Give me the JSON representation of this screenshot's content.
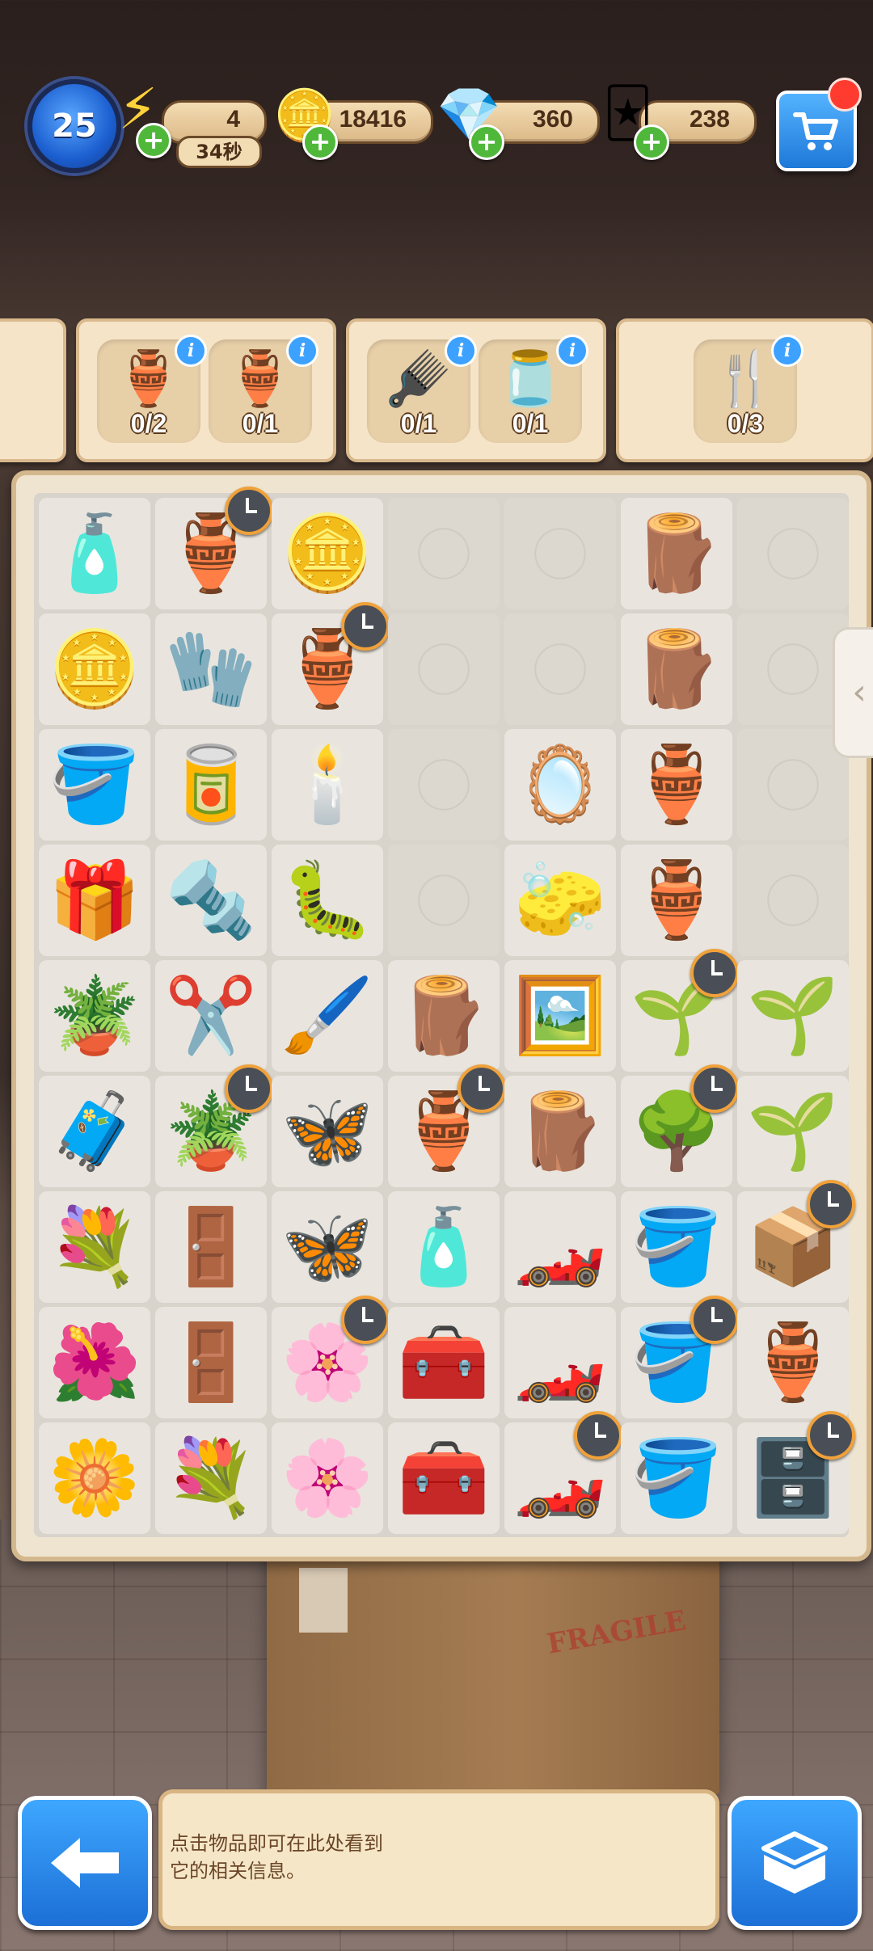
{
  "top_bar": {
    "level": "25",
    "energy": {
      "value": "4",
      "timer": "34秒",
      "icon": "lightning-icon"
    },
    "coins": {
      "value": "18416",
      "icon": "coin-icon"
    },
    "gems": {
      "value": "360",
      "icon": "diamond-icon"
    },
    "cards": {
      "value": "238",
      "icon": "card-icon"
    },
    "cart_icon": "shopping-cart-icon"
  },
  "orders": [
    {
      "items": [
        {
          "name": "golden-ewer",
          "glyph": "🏺",
          "count": "0/2"
        },
        {
          "name": "painted-vase",
          "glyph": "🏺",
          "count": "0/1"
        }
      ]
    },
    {
      "items": [
        {
          "name": "brush",
          "glyph": "🪮",
          "count": "0/1"
        },
        {
          "name": "cream-jar",
          "glyph": "🫙",
          "count": "0/1"
        }
      ]
    },
    {
      "items": [
        {
          "name": "cutlery",
          "glyph": "🍴",
          "count": "0/3"
        }
      ]
    }
  ],
  "board": {
    "rows": [
      [
        "🧴",
        "🏺",
        "🪙",
        "",
        "",
        "🪵"
      ],
      [
        "🪙",
        "🧤",
        "🏺",
        "",
        "",
        "🪵"
      ],
      [
        "🪣",
        "🥫",
        "🕯️",
        "",
        "🪞",
        "🏺"
      ],
      [
        "🎁",
        "🔩",
        "🐛",
        "",
        "🧽",
        "🏺"
      ],
      [
        "🪴",
        "✂️",
        "🖌️",
        "🪵",
        "🖼️",
        "🌱"
      ],
      [
        "🧳",
        "🪴",
        "🦋",
        "🏺",
        "🪵",
        "🌳"
      ],
      [
        "💐",
        "🚪",
        "🦋",
        "🧴",
        "🏎️",
        "🪣"
      ],
      [
        "🌺",
        "🚪",
        "🌸",
        "🧰",
        "🏎️",
        "🪣"
      ],
      [
        "🌼",
        "💐",
        "🌸",
        "🧰",
        "🏎️",
        "🪣"
      ]
    ],
    "extra_right_column": [
      "",
      "",
      "",
      "",
      "🌱",
      "🌱",
      "📦",
      "🏺",
      "🗄️"
    ]
  },
  "info_panel": {
    "text_line1": "点击物品即可在此处看到",
    "text_line2": "它的相关信息。"
  },
  "buttons": {
    "back_icon": "back-arrow-icon",
    "inventory_icon": "box-icon"
  }
}
